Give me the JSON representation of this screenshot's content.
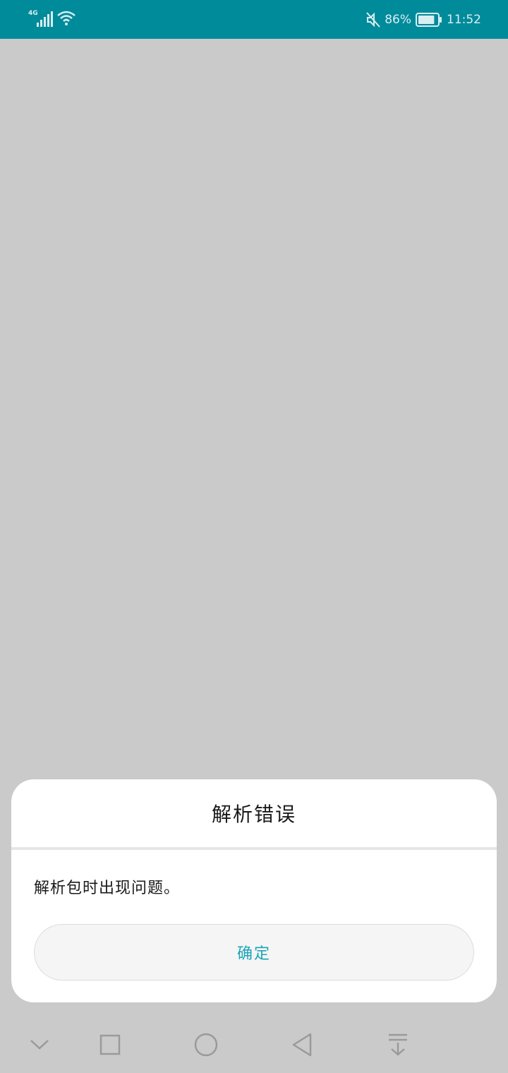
{
  "status_bar": {
    "network_type": "4G",
    "signal_icon": "signal-bars-icon",
    "wifi_icon": "wifi-icon",
    "mute_icon": "mute-icon",
    "battery_percent": "86%",
    "battery_level": 0.86,
    "time": "11:52",
    "colors": {
      "background": "#008b9b",
      "foreground": "#d9eef1"
    }
  },
  "dialog": {
    "title": "解析错误",
    "message": "解析包时出现问题。",
    "confirm_label": "确定",
    "accent_color": "#1aa5b8"
  },
  "nav_bar": {
    "items": [
      {
        "icon": "chevron-down-icon"
      },
      {
        "icon": "recents-square-icon"
      },
      {
        "icon": "home-circle-icon"
      },
      {
        "icon": "back-triangle-icon"
      },
      {
        "icon": "notification-pull-down-icon"
      }
    ]
  }
}
